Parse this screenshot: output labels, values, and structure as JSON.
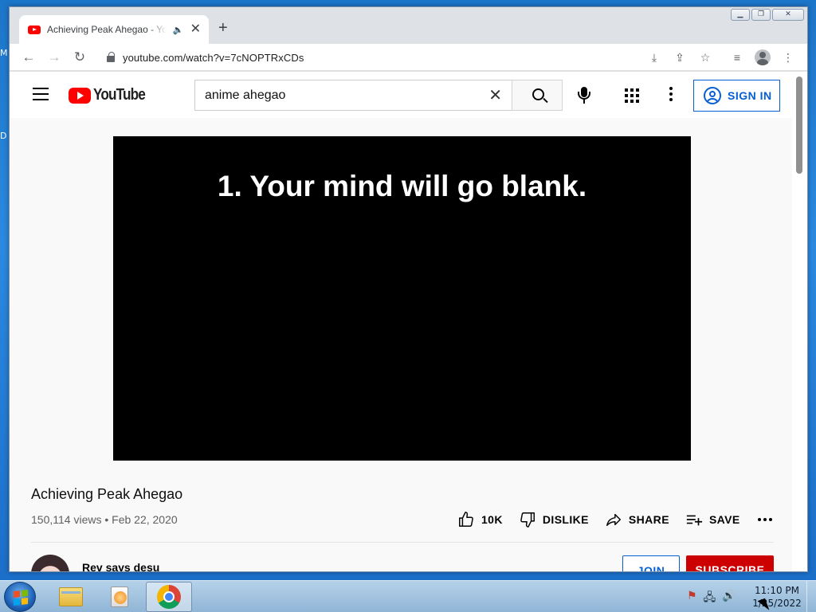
{
  "desktop": {
    "edge_labels": [
      "M",
      "D"
    ]
  },
  "browser": {
    "tab": {
      "title": "Achieving Peak Ahegao - YouTube",
      "audio_icon": "speaker-icon",
      "close_symbol": "✕"
    },
    "new_tab_symbol": "+",
    "window_controls": {
      "minimize": "▭",
      "restore": "❐",
      "close": "✕"
    },
    "nav": {
      "back": "←",
      "forward": "→",
      "reload": "↻"
    },
    "url": "youtube.com/watch?v=7cNOPTRxCDs",
    "toolbar_icons": {
      "install": "⤓",
      "share": "⇪",
      "bookmark": "☆",
      "reading_list": "≡",
      "menu": "⋮"
    }
  },
  "youtube": {
    "logo_text": "YouTube",
    "search": {
      "query": "anime ahegao",
      "clear_symbol": "✕"
    },
    "sign_in_label": "SIGN IN",
    "player": {
      "caption": "1. Your mind will go blank."
    },
    "video": {
      "title": "Achieving Peak Ahegao",
      "views": "150,114 views",
      "separator": "•",
      "date": "Feb 22, 2020"
    },
    "actions": {
      "like_count": "10K",
      "dislike_label": "DISLIKE",
      "share_label": "SHARE",
      "save_label": "SAVE"
    },
    "channel": {
      "name": "Rev says desu",
      "join_label": "JOIN",
      "subscribe_label": "SUBSCRIBE"
    },
    "colors": {
      "brand_red": "#ff0000",
      "link_blue": "#065fd4",
      "subscribe_red": "#cc0000"
    }
  },
  "taskbar": {
    "time": "11:10 PM",
    "date": "1/25/2022",
    "tray_icons": [
      "flag-alert-icon",
      "network-icon",
      "volume-icon"
    ]
  }
}
